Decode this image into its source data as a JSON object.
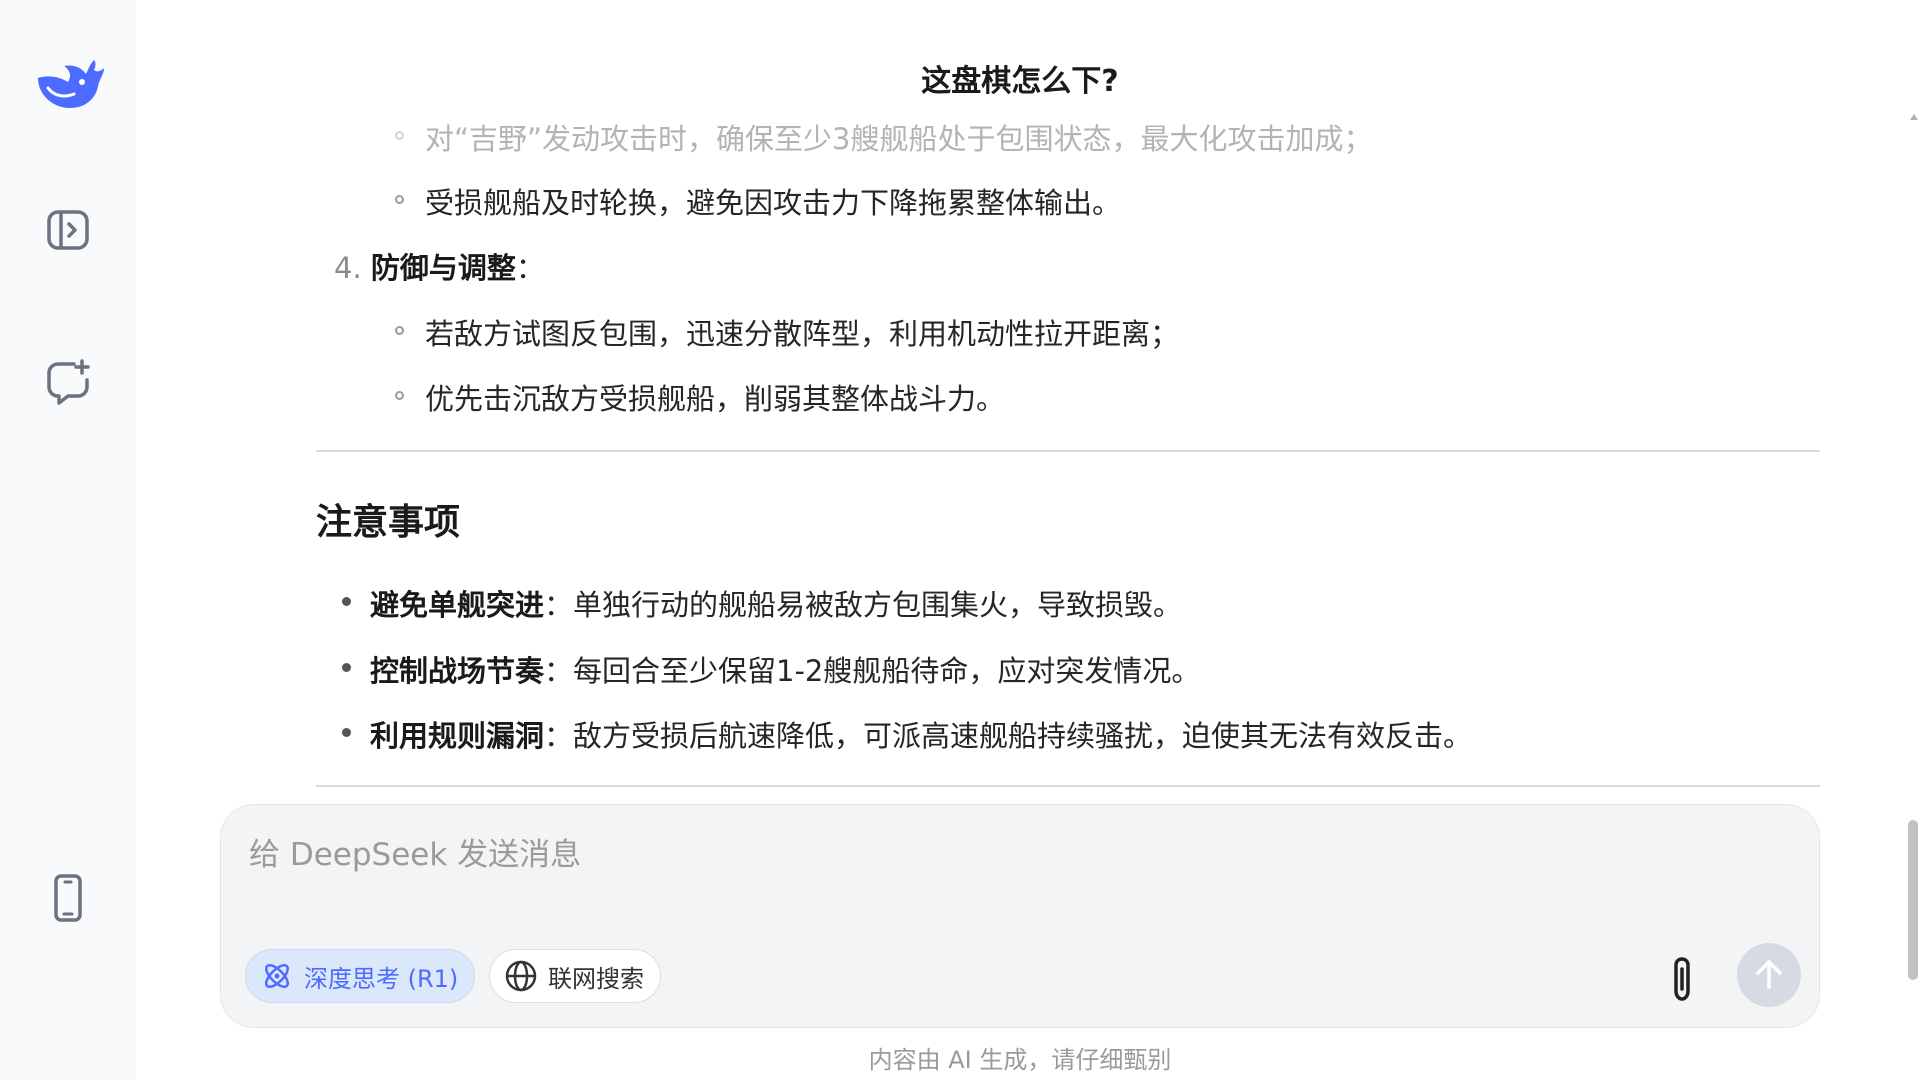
{
  "title": "这盘棋怎么下?",
  "list_items": {
    "item_a": "对“吉野”发动攻击时，确保至少3艘舰船处于包围状态，最大化攻击加成；",
    "item_b": "受损舰船及时轮换，避免因攻击力下降拖累整体输出。",
    "section4_num": "4.",
    "section4_title": "防御与调整",
    "section4_colon": "：",
    "item_c": "若敌方试图反包围，迅速分散阵型，利用机动性拉开距离；",
    "item_d": "优先击沉敌方受损舰船，削弱其整体战斗力。"
  },
  "notes": {
    "heading": "注意事项",
    "items": [
      {
        "bold": "避免单舰突进",
        "text": "：单独行动的舰船易被敌方包围集火，导致损毁。"
      },
      {
        "bold": "控制战场节奏",
        "text": "：每回合至少保留1-2艘舰船待命，应对突发情况。"
      },
      {
        "bold": "利用规则漏洞",
        "text": "：敌方受损后航速降低，可派高速舰船持续骚扰，迫使其无法有效反击。"
      }
    ]
  },
  "input": {
    "placeholder": "给 DeepSeek 发送消息",
    "value": ""
  },
  "buttons": {
    "deep_think": "深度思考 (R1)",
    "web_search": "联网搜索"
  },
  "disclaimer": "内容由 AI 生成，请仔细甄别",
  "colors": {
    "accent": "#4d6bfe",
    "sidebar_bg": "#f9fafb",
    "input_bg": "#f3f4f6"
  },
  "icons": {
    "logo": "deepseek-whale-icon",
    "sidebar_toggle": "sidebar-open-icon",
    "new_chat": "new-chat-icon",
    "mobile": "mobile-phone-icon",
    "deep_think": "atom-icon",
    "web_search": "globe-icon",
    "attach": "paperclip-icon",
    "send": "arrow-up-icon"
  }
}
